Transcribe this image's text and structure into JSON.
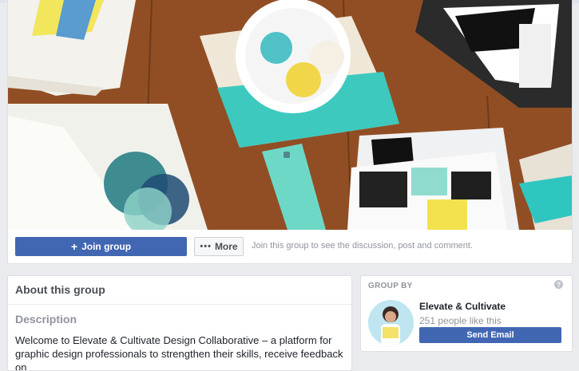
{
  "cover": {
    "image": "flat-lay-workspace-photo",
    "colors": {
      "wood": "#8a4a22",
      "teal": "#3ec9bf",
      "accent_yellow": "#f2d64a"
    }
  },
  "actions": {
    "join_label": "Join group",
    "join_icon": "plus-icon",
    "more_label": "More",
    "more_icon": "ellipsis-icon",
    "join_info": "Join this group to see the discussion, post and comment."
  },
  "about": {
    "title": "About this group",
    "description_heading": "Description",
    "description_text": "Welcome to Elevate & Cultivate Design Collaborative – a platform for graphic design professionals to strengthen their skills, receive feedback on"
  },
  "group_by": {
    "label": "GROUP BY",
    "help_icon": "question-icon",
    "page_name": "Elevate & Cultivate",
    "likes": "251 people like this",
    "send_label": "Send Email"
  },
  "colors": {
    "primary": "#4267b2",
    "background": "#e9ebee"
  }
}
